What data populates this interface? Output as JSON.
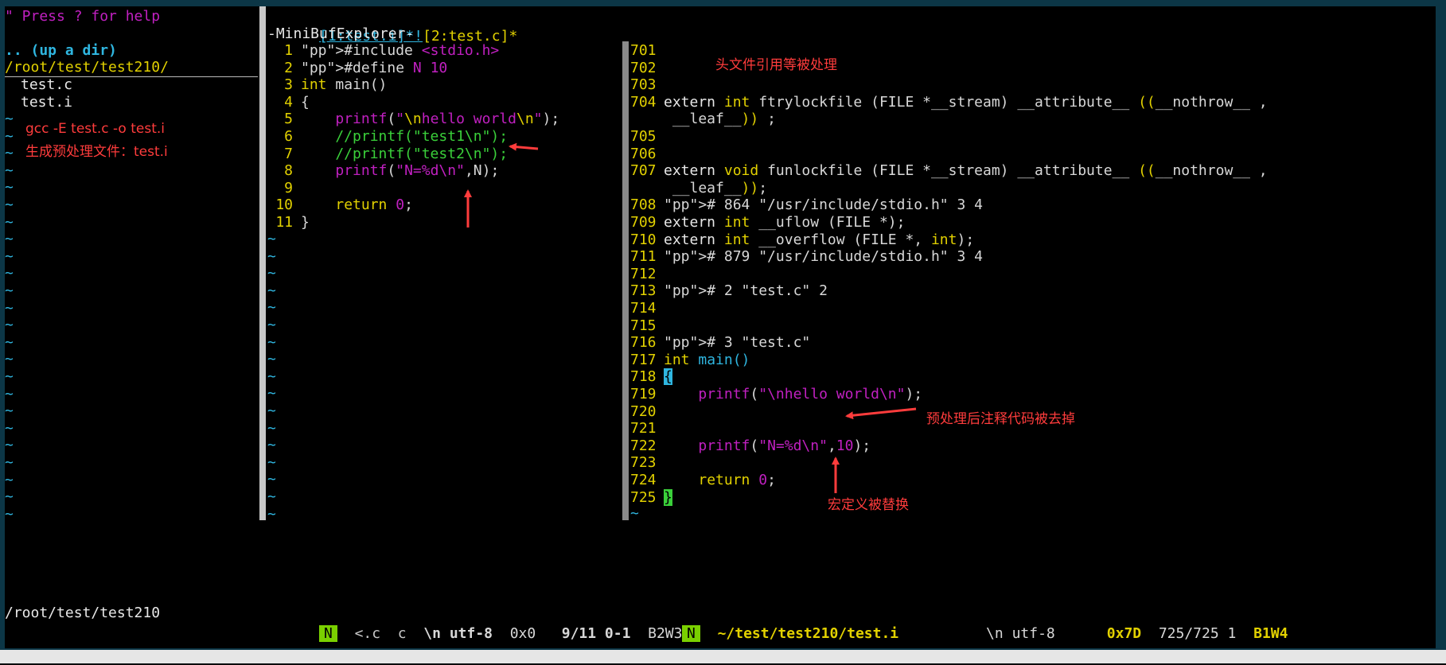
{
  "left_pane": {
    "help_line": "\" Press ? for help",
    "up_dir": ".. (up a dir)",
    "current_dir": "/root/test/test210/",
    "files": [
      "test.c",
      "test.i"
    ],
    "status_path": "/root/test/test210"
  },
  "minibuf": {
    "tab1": "[1:test.i]*!",
    "tab2": "[2:test.c]*",
    "title": "-MiniBufExplorer-"
  },
  "middle_pane": {
    "lines": [
      {
        "n": "1",
        "code": "#include <stdio.h>"
      },
      {
        "n": "2",
        "code": "#define N 10"
      },
      {
        "n": "3",
        "code": "int main()"
      },
      {
        "n": "4",
        "code": "{"
      },
      {
        "n": "5",
        "code": "    printf(\"\\nhello world\\n\");"
      },
      {
        "n": "6",
        "code": "    //printf(\"test1\\n\");"
      },
      {
        "n": "7",
        "code": "    //printf(\"test2\\n\");"
      },
      {
        "n": "8",
        "code": "    printf(\"N=%d\\n\",N);"
      },
      {
        "n": "9",
        "code": ""
      },
      {
        "n": "10",
        "code": "    return 0;"
      },
      {
        "n": "11",
        "code": "}"
      }
    ],
    "status": {
      "mode": "N",
      "filetype": "<.c",
      "ft": "c",
      "eol": "\\n",
      "enc": "utf-8",
      "hex": "0x0",
      "pos": "9/11 0-1",
      "bufwin": "B2W3"
    }
  },
  "right_pane": {
    "lines": [
      {
        "n": "701",
        "code": ""
      },
      {
        "n": "702",
        "code": ""
      },
      {
        "n": "703",
        "code": ""
      },
      {
        "n": "704",
        "code": "extern int ftrylockfile (FILE *__stream) __attribute__ ((__nothrow__ ,"
      },
      {
        "n": "",
        "code": " __leaf__)) ;"
      },
      {
        "n": "705",
        "code": ""
      },
      {
        "n": "706",
        "code": ""
      },
      {
        "n": "707",
        "code": "extern void funlockfile (FILE *__stream) __attribute__ ((__nothrow__ ,"
      },
      {
        "n": "",
        "code": " __leaf__));"
      },
      {
        "n": "708",
        "code": "# 864 \"/usr/include/stdio.h\" 3 4"
      },
      {
        "n": "709",
        "code": "extern int __uflow (FILE *);"
      },
      {
        "n": "710",
        "code": "extern int __overflow (FILE *, int);"
      },
      {
        "n": "711",
        "code": "# 879 \"/usr/include/stdio.h\" 3 4"
      },
      {
        "n": "712",
        "code": ""
      },
      {
        "n": "713",
        "code": "# 2 \"test.c\" 2"
      },
      {
        "n": "714",
        "code": ""
      },
      {
        "n": "715",
        "code": ""
      },
      {
        "n": "716",
        "code": "# 3 \"test.c\""
      },
      {
        "n": "717",
        "code": "int main()"
      },
      {
        "n": "718",
        "code": "{"
      },
      {
        "n": "719",
        "code": "    printf(\"\\nhello world\\n\");"
      },
      {
        "n": "720",
        "code": ""
      },
      {
        "n": "721",
        "code": ""
      },
      {
        "n": "722",
        "code": "    printf(\"N=%d\\n\",10);"
      },
      {
        "n": "723",
        "code": ""
      },
      {
        "n": "724",
        "code": "    return 0;"
      },
      {
        "n": "725",
        "code": "}"
      }
    ],
    "status": {
      "mode": "N",
      "path": "~/test/test210/test.i",
      "eol": "\\n",
      "enc": "utf-8",
      "hex": "0x7D",
      "pos": "725/725 1",
      "bufwin": "B1W4"
    }
  },
  "annotations": {
    "gcc_cmd": "gcc -E test.c  -o test.i",
    "gen_file": "生成预处理文件：test.i",
    "header_processed": "头文件引用等被处理",
    "comments_removed": "预处理后注释代码被去掉",
    "macro_replaced": "宏定义被替换"
  },
  "colors": {
    "accent_red": "#ff3c3c",
    "keyword_yellow": "#e2d100",
    "preproc_magenta": "#c020c0",
    "comment_green": "#3ad03a",
    "tilde_cyan": "#2fb6e0",
    "mode_badge": "#7ad000"
  }
}
